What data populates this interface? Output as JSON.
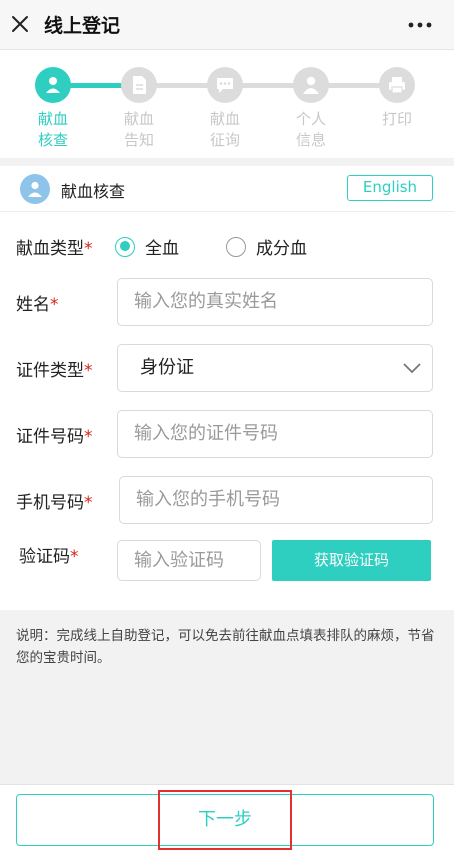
{
  "header": {
    "title": "线上登记",
    "close_icon": "close-icon",
    "more_icon": "more-icon"
  },
  "steps": [
    {
      "line1": "献血",
      "line2": "核查",
      "active": true,
      "icon": "donor-icon"
    },
    {
      "line1": "献血",
      "line2": "告知",
      "active": false,
      "icon": "document-icon"
    },
    {
      "line1": "献血",
      "line2": "征询",
      "active": false,
      "icon": "chat-icon"
    },
    {
      "line1": "个人",
      "line2": "信息",
      "active": false,
      "icon": "person-icon"
    },
    {
      "line1": "打印",
      "line2": "",
      "active": false,
      "icon": "printer-icon"
    }
  ],
  "section": {
    "title": "献血核查",
    "english_label": "English"
  },
  "form": {
    "blood_type_label": "献血类型",
    "blood_type_options": [
      "全血",
      "成分血"
    ],
    "blood_type_selected": "全血",
    "name_label": "姓名",
    "name_placeholder": "输入您的真实姓名",
    "id_type_label": "证件类型",
    "id_type_value": "身份证",
    "id_number_label": "证件号码",
    "id_number_placeholder": "输入您的证件号码",
    "phone_label": "手机号码",
    "phone_placeholder": "输入您的手机号码",
    "code_label": "验证码",
    "code_placeholder": "输入验证码",
    "get_code_label": "获取验证码",
    "required_mark": "*"
  },
  "note": "说明：完成线上自助登记，可以免去前往献血点填表排队的麻烦，节省您的宝贵时间。",
  "next_label": "下一步",
  "colors": {
    "accent": "#2ecfc0",
    "required": "#d8231c",
    "highlight": "#e03030"
  }
}
